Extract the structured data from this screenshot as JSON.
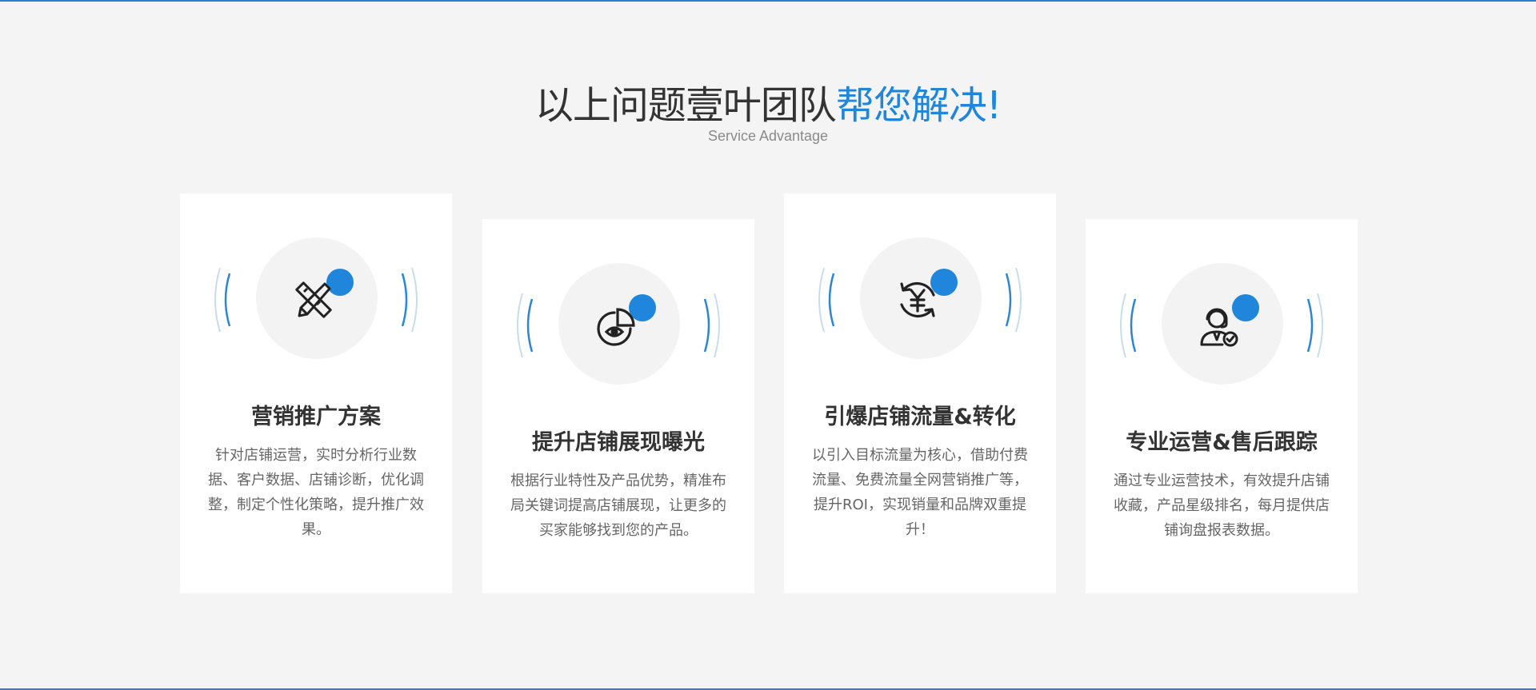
{
  "section": {
    "title_prefix": "以上问题壹叶团队",
    "title_accent": "帮您解决!",
    "subtitle": "Service Advantage"
  },
  "cards": [
    {
      "icon": "ruler-pencil-icon",
      "title": "营销推广方案",
      "description": "针对店铺运营，实时分析行业数据、客户数据、店铺诊断，优化调整，制定个性化策略，提升推广效果。"
    },
    {
      "icon": "pie-chart-eye-icon",
      "title": "提升店铺展现曝光",
      "description": "根据行业特性及产品优势，精准布局关键词提高店铺展现，让更多的买家能够找到您的产品。"
    },
    {
      "icon": "yuan-cycle-icon",
      "title": "引爆店铺流量&转化",
      "description": "以引入目标流量为核心，借助付费流量、免费流量全网营销推广等，提升ROI，实现销量和品牌双重提升！"
    },
    {
      "icon": "customer-service-icon",
      "title": "专业运营&售后跟踪",
      "description": "通过专业运营技术，有效提升店铺收藏，产品星级排名，每月提供店铺询盘报表数据。"
    }
  ],
  "colors": {
    "accent": "#1f86db",
    "background": "#f4f4f4",
    "card": "#ffffff",
    "title_text": "#333333",
    "body_text": "#666666"
  }
}
